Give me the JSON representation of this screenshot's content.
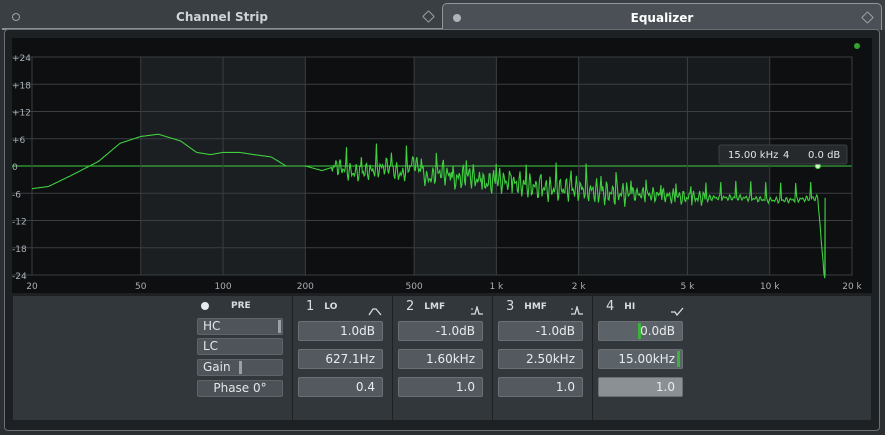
{
  "tabs": [
    {
      "label": "Channel Strip",
      "active": false
    },
    {
      "label": "Equalizer",
      "active": true
    }
  ],
  "graph": {
    "y_ticks": [
      "+24",
      "+18",
      "+12",
      "+6",
      "0",
      "-6",
      "-12",
      "-18",
      "-24"
    ],
    "x_ticks": [
      "20",
      "50",
      "100",
      "200",
      "500",
      "1 k",
      "2 k",
      "5 k",
      "10 k",
      "20 k"
    ],
    "tooltip": {
      "freq": "15.00 kHz",
      "band": "4",
      "gain": "0.0 dB"
    },
    "indicator_color": "#2fa62f",
    "curve_color": "#3fcf3f"
  },
  "chart_data": {
    "type": "line",
    "xlabel": "",
    "ylabel": "",
    "xscale": "log",
    "xlim": [
      20,
      20000
    ],
    "ylim": [
      -24,
      24
    ],
    "grid": true,
    "series": [
      {
        "x": [
          20,
          23,
          28,
          35,
          42,
          50,
          58,
          70,
          80,
          90,
          100,
          115,
          130,
          150,
          170,
          200,
          230,
          260,
          300,
          350,
          400,
          450,
          500,
          560,
          630,
          700,
          800,
          900,
          1000,
          1200,
          1500,
          2000,
          2500,
          3000,
          4000,
          5000,
          6000,
          8000,
          10000,
          12000,
          15000,
          15800,
          16000
        ],
        "y": [
          -5,
          -4.5,
          -2,
          1,
          5,
          6.5,
          7,
          5.5,
          3,
          2.5,
          3,
          3,
          2.5,
          2,
          0,
          0,
          -1,
          0,
          -1.5,
          -1,
          0,
          -2,
          1,
          -3,
          -1,
          -3,
          -2,
          -4,
          -3,
          -4,
          -5,
          -5,
          -6,
          -6,
          -6.5,
          -7,
          -7,
          -7,
          -7.5,
          -7.5,
          -7,
          -24,
          -24
        ]
      }
    ]
  },
  "left": {
    "pre_label": "PRE",
    "hc": "HC",
    "lc": "LC",
    "gain": "Gain",
    "phase": "Phase 0°"
  },
  "bands": [
    {
      "num": "1",
      "type": "LO",
      "gain": "1.0dB",
      "freq": "627.1Hz",
      "q": "0.4"
    },
    {
      "num": "2",
      "type": "LMF",
      "gain": "-1.0dB",
      "freq": "1.60kHz",
      "q": "1.0"
    },
    {
      "num": "3",
      "type": "HMF",
      "gain": "-1.0dB",
      "freq": "2.50kHz",
      "q": "1.0"
    },
    {
      "num": "4",
      "type": "HI",
      "gain": "0.0dB",
      "freq": "15.00kHz",
      "q": "1.0"
    }
  ]
}
